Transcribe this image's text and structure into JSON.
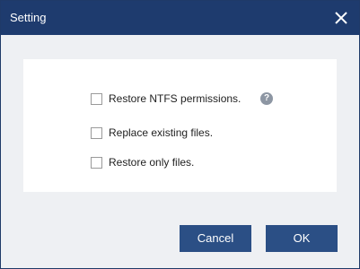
{
  "window": {
    "title": "Setting",
    "close_icon": "close-icon"
  },
  "options": [
    {
      "label": "Restore NTFS permissions.",
      "checked": false
    },
    {
      "label": "Replace existing files.",
      "checked": false
    },
    {
      "label": "Restore only files.",
      "checked": false
    }
  ],
  "help": {
    "glyph": "?",
    "icon": "help-icon"
  },
  "buttons": {
    "cancel": "Cancel",
    "ok": "OK"
  },
  "colors": {
    "titlebar": "#1e3b6e",
    "button": "#2b4f85",
    "background": "#eef0f3",
    "panel": "#ffffff"
  }
}
